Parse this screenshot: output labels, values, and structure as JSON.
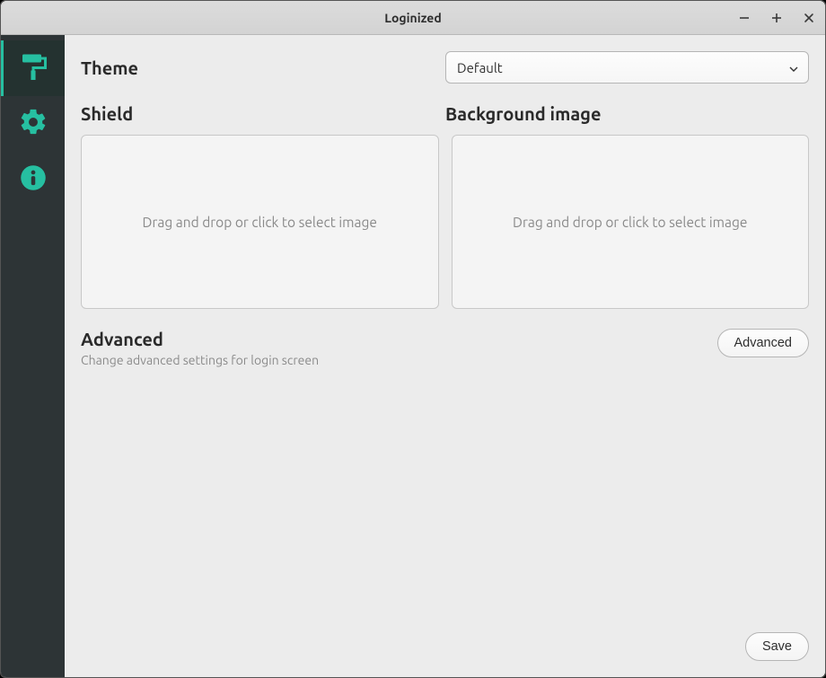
{
  "window": {
    "title": "Loginized"
  },
  "sidebar": {
    "items": [
      {
        "name": "appearance",
        "active": true
      },
      {
        "name": "settings",
        "active": false
      },
      {
        "name": "about",
        "active": false
      }
    ]
  },
  "main": {
    "theme": {
      "label": "Theme",
      "selected": "Default"
    },
    "shield": {
      "label": "Shield",
      "dropzone_text": "Drag and drop or click to select image"
    },
    "background": {
      "label": "Background image",
      "dropzone_text": "Drag and drop or click to select image"
    },
    "advanced": {
      "label": "Advanced",
      "sub": "Change advanced settings for login screen",
      "button": "Advanced"
    },
    "save_button": "Save"
  }
}
